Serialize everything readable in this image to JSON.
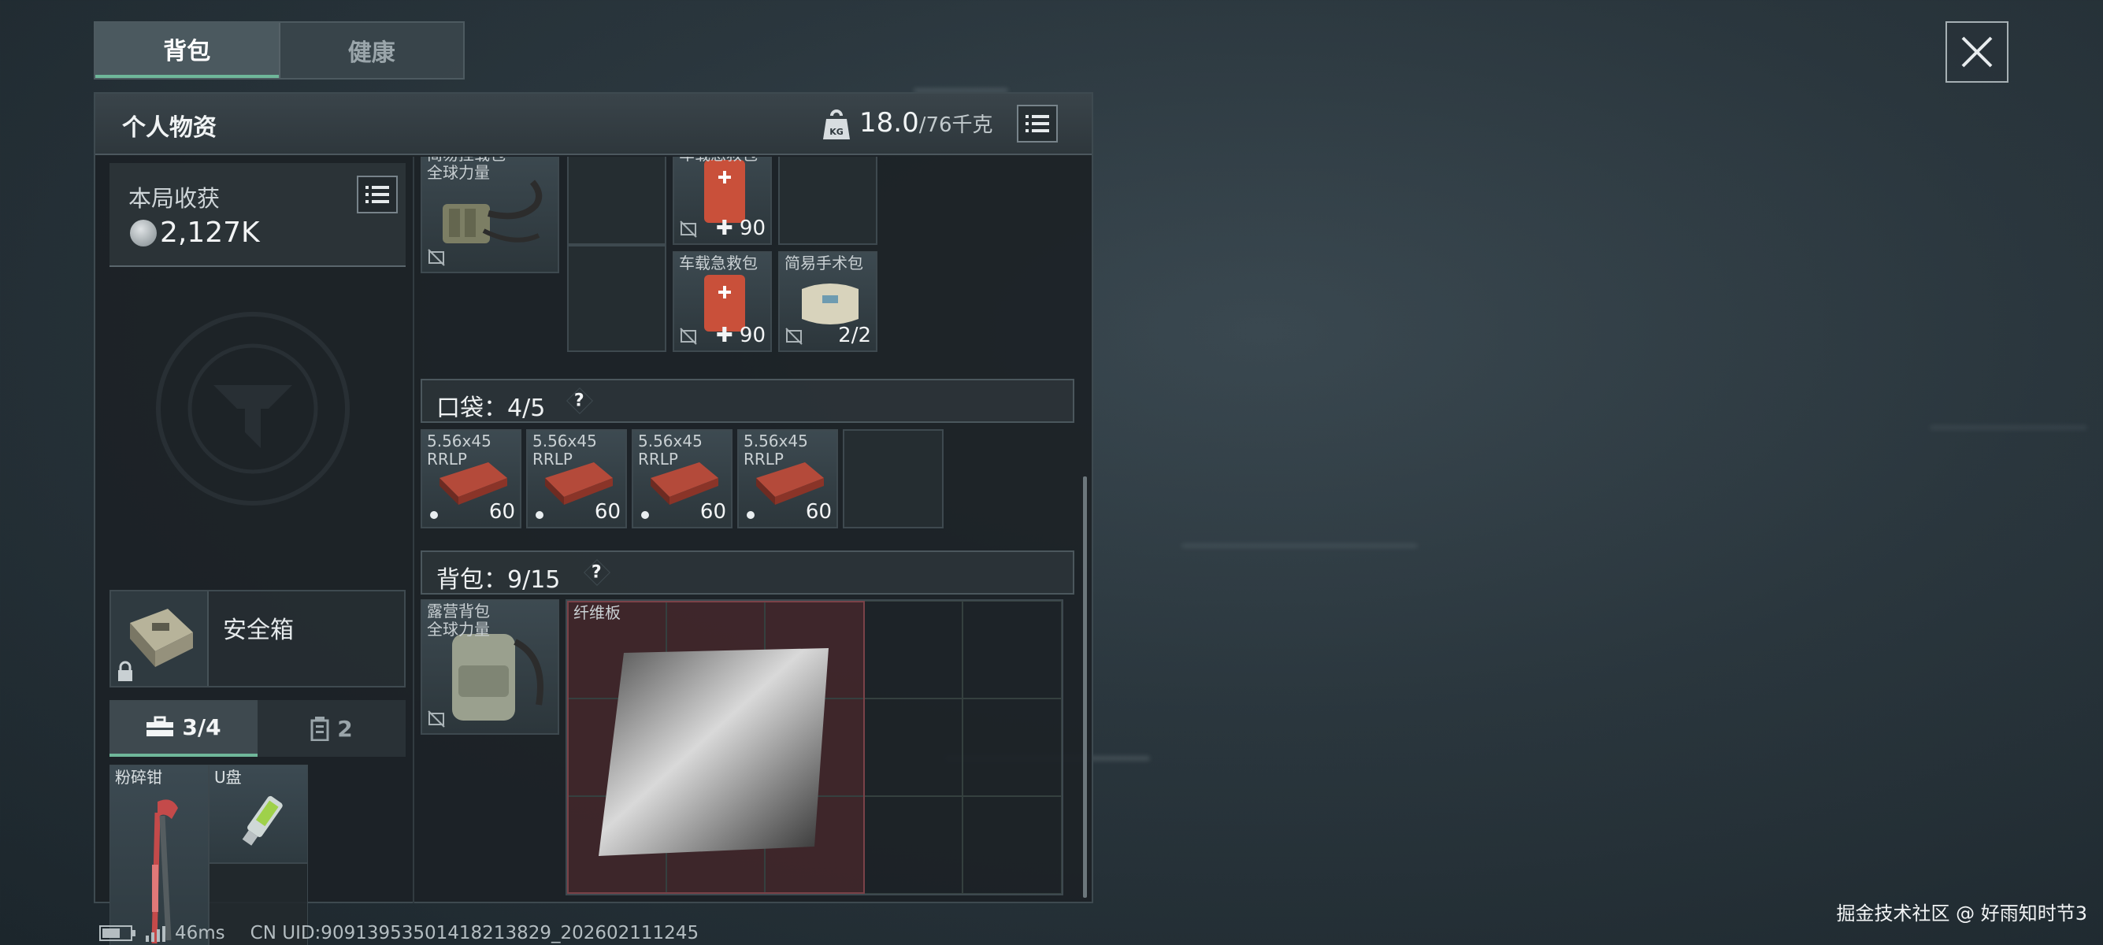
{
  "tabs": [
    {
      "label": "背包",
      "active": true
    },
    {
      "label": "健康",
      "active": false
    }
  ],
  "header": {
    "title": "个人物资",
    "weight_current": "18.0",
    "weight_max": "/76千克",
    "weight_icon_text": "KG"
  },
  "harvest": {
    "label": "本局收获",
    "value": "2,127K"
  },
  "safe_box": {
    "label": "安全箱"
  },
  "subtabs": [
    {
      "label": "3/4",
      "icon": "toolbox-icon",
      "active": true
    },
    {
      "label": "2",
      "icon": "canister-icon",
      "active": false
    }
  ],
  "tools": [
    {
      "name": "U盘"
    },
    {
      "name": "粉碎钳"
    }
  ],
  "rig_items": {
    "rig": {
      "name": "简易挂载包\n全球力量"
    },
    "kit1": {
      "name": "车载急救包",
      "count": "90"
    },
    "kit2": {
      "name": "车载急救包",
      "count": "90"
    },
    "surgery": {
      "name": "简易手术包",
      "count": "2/2"
    }
  },
  "pocket": {
    "label": "口袋：4/5",
    "items": [
      {
        "name": "5.56x45\nRRLP",
        "count": "60"
      },
      {
        "name": "5.56x45\nRRLP",
        "count": "60"
      },
      {
        "name": "5.56x45\nRRLP",
        "count": "60"
      },
      {
        "name": "5.56x45\nRRLP",
        "count": "60"
      }
    ]
  },
  "backpack": {
    "label": "背包：9/15",
    "bag_name": "露营背包\n全球力量",
    "board_name": "纤维板"
  },
  "help_text": "?",
  "footer": {
    "ping": "46ms",
    "uid": "CN UID:9091395350141821382​9_202602111245"
  },
  "watermark": "掘金技术社区 @ 好雨知时节3",
  "colors": {
    "accent": "#6fb79a",
    "medkit": "#c9503a",
    "board_highlight": "#5a2a2e"
  }
}
